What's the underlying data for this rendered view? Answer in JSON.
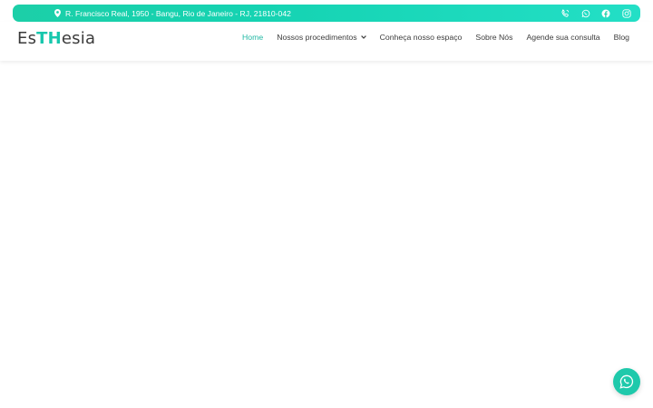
{
  "topbar": {
    "address": "R. Francisco Real, 1950 - Bangu, Rio de Janeiro - RJ, 21810-042",
    "icons": [
      "map-pin-icon",
      "phone-icon",
      "whatsapp-icon",
      "facebook-icon",
      "instagram-icon"
    ]
  },
  "header": {
    "logo": {
      "part1": "Es",
      "part2": "TH",
      "part3": "esia"
    },
    "nav": [
      {
        "label": "Home",
        "active": true
      },
      {
        "label": "Nossos procedimentos",
        "has_dropdown": true
      },
      {
        "label": "Conheça nosso espaço"
      },
      {
        "label": "Sobre Nós"
      },
      {
        "label": "Agende sua consulta"
      },
      {
        "label": "Blog"
      }
    ]
  },
  "floating": {
    "icon": "whatsapp-icon"
  },
  "colors": {
    "accent": "#1ccfa8",
    "accent_dark": "#22b8a4",
    "text": "#3c3c3c"
  }
}
